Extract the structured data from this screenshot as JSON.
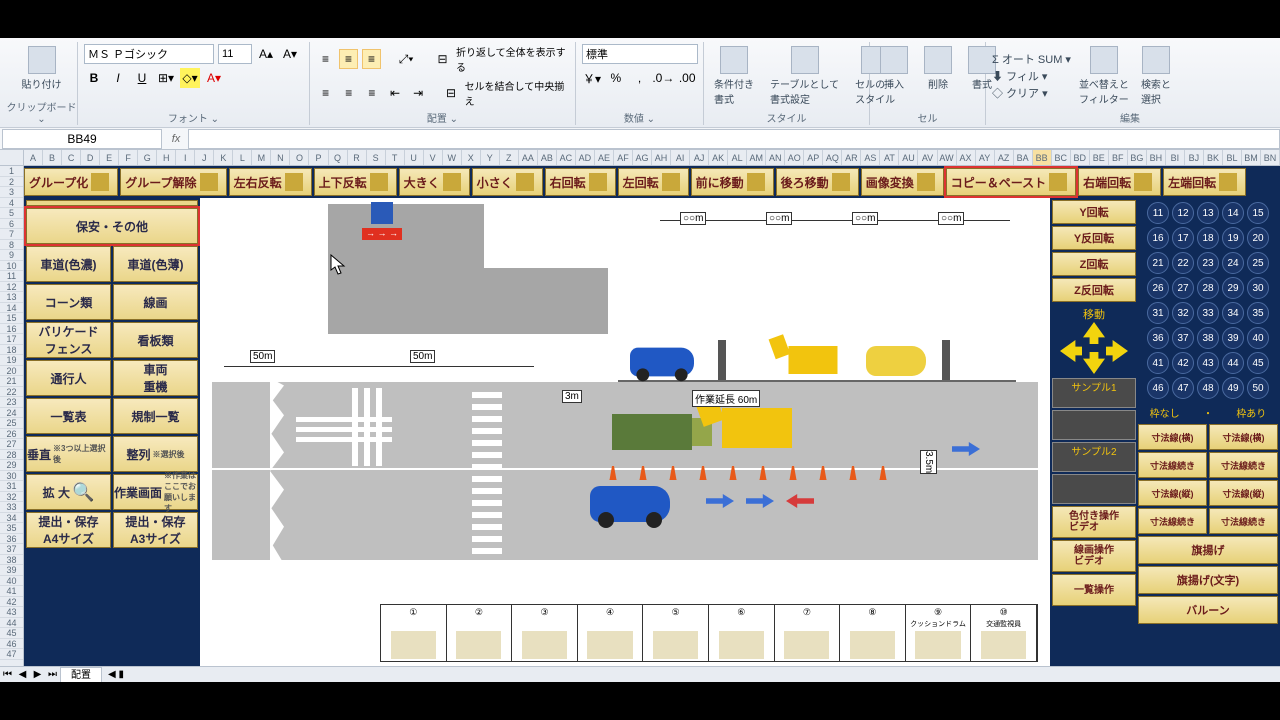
{
  "ribbon": {
    "clipboard": {
      "paste": "貼り付け",
      "label": "クリップボード"
    },
    "font": {
      "name": "ＭＳ Ｐゴシック",
      "size": "11",
      "label": "フォント",
      "bold": "B",
      "italic": "I",
      "underline": "U"
    },
    "align": {
      "wrap": "折り返して全体を表示する",
      "merge": "セルを結合して中央揃え",
      "label": "配置"
    },
    "number": {
      "format": "標準",
      "label": "数値"
    },
    "style": {
      "cond": "条件付き\n書式",
      "table": "テーブルとして\n書式設定",
      "cell": "セルの\nスタイル",
      "label": "スタイル"
    },
    "cells": {
      "insert": "挿入",
      "delete": "削除",
      "format": "書式",
      "label": "セル"
    },
    "editing": {
      "autosum": "オート SUM",
      "fill": "フィル",
      "clear": "クリア",
      "sort": "並べ替えと\nフィルター",
      "find": "検索と\n選択",
      "label": "編集"
    }
  },
  "namebox": "BB49",
  "columns": [
    "A",
    "B",
    "C",
    "D",
    "E",
    "F",
    "G",
    "H",
    "I",
    "J",
    "K",
    "L",
    "M",
    "N",
    "O",
    "P",
    "Q",
    "R",
    "S",
    "T",
    "U",
    "V",
    "W",
    "X",
    "Y",
    "Z",
    "AA",
    "AB",
    "AC",
    "AD",
    "AE",
    "AF",
    "AG",
    "AH",
    "AI",
    "AJ",
    "AK",
    "AL",
    "AM",
    "AN",
    "AO",
    "AP",
    "AQ",
    "AR",
    "AS",
    "AT",
    "AU",
    "AV",
    "AW",
    "AX",
    "AY",
    "AZ",
    "BA",
    "BB",
    "BC",
    "BD",
    "BE",
    "BF",
    "BG",
    "BH",
    "BI",
    "BJ",
    "BK",
    "BL",
    "BM",
    "BN"
  ],
  "rows_max": 47,
  "topbtns": [
    "グループ化",
    "グループ解除",
    "左右反転",
    "上下反転",
    "大きく",
    "小さく",
    "右回転",
    "左回転",
    "前に移動",
    "後ろ移動",
    "画像変換",
    "コピー＆ペースト",
    "右端回転",
    "左端回転"
  ],
  "topbtn_sel": 11,
  "palette": [
    [
      "保安・その他"
    ],
    [
      "車道(色濃)",
      "車道(色薄)"
    ],
    [
      "コーン類",
      "線画"
    ],
    [
      "バリケード\nフェンス",
      "看板類"
    ],
    [
      "通行人",
      "車両\n重機"
    ],
    [
      "一覧表",
      "規制一覧"
    ],
    [
      "垂直",
      "整列"
    ],
    [
      "拡 大",
      "作業画面"
    ],
    [
      "提出・保存\nA4サイズ",
      "提出・保存\nA3サイズ"
    ]
  ],
  "palette_sub": {
    "6a": "※3つ以上選択後",
    "6b": "※選択後",
    "7b": "※作業はここでお願いします"
  },
  "canvas": {
    "dim50a": "50m",
    "dim50b": "50m",
    "dim3m": "3m",
    "dim35m": "3.5m",
    "work_label": "作業延長 60m",
    "top_dims": [
      "○○m",
      "○○m",
      "○○m",
      "○○m"
    ],
    "table_nums": [
      "①",
      "②",
      "③",
      "④",
      "⑤",
      "⑥",
      "⑦",
      "⑧",
      "⑨",
      "⑩"
    ],
    "table_lbl9": "クッションドラム",
    "table_lbl10": "交通監視員"
  },
  "rcol1": {
    "btns": [
      "Y回転",
      "Y反回転",
      "Z回転",
      "Z反回転"
    ],
    "move": "移動",
    "sample1": "サンプル1",
    "sample2": "サンプル2",
    "vids": [
      "色付き操作\nビデオ",
      "線画操作\nビデオ",
      "一覧操作"
    ]
  },
  "rcol2": {
    "nums": [
      11,
      12,
      13,
      14,
      15,
      16,
      17,
      18,
      19,
      20,
      21,
      22,
      23,
      24,
      25,
      26,
      27,
      28,
      29,
      30,
      31,
      32,
      33,
      34,
      35,
      36,
      37,
      38,
      39,
      40,
      41,
      42,
      43,
      44,
      45,
      46,
      47,
      48,
      49,
      50
    ],
    "frame": [
      "枠なし",
      "・",
      "枠あり"
    ],
    "dim_btns": [
      [
        "寸法線(横)",
        "寸法線(横)"
      ],
      [
        "寸法線続き",
        "寸法線続き"
      ],
      [
        "寸法線(縦)",
        "寸法線(縦)"
      ],
      [
        "寸法線続き",
        "寸法線続き"
      ]
    ],
    "extra": [
      "旗揚げ",
      "旗揚げ(文字)",
      "バルーン"
    ]
  },
  "sheet": {
    "tab": "配置"
  }
}
